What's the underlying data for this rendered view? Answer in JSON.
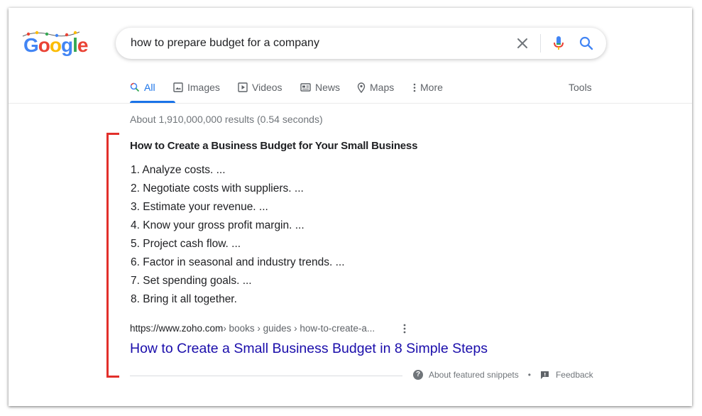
{
  "logo": {
    "text": "Google"
  },
  "search": {
    "query": "how to prepare budget for a company"
  },
  "tabs": [
    {
      "label": "All",
      "icon": "search-icon"
    },
    {
      "label": "Images",
      "icon": "image-icon"
    },
    {
      "label": "Videos",
      "icon": "play-icon"
    },
    {
      "label": "News",
      "icon": "news-icon"
    },
    {
      "label": "Maps",
      "icon": "map-pin-icon"
    },
    {
      "label": "More",
      "icon": "more-vert-icon"
    }
  ],
  "tools_label": "Tools",
  "stats": "About 1,910,000,000 results (0.54 seconds)",
  "snippet": {
    "title": "How to Create a Business Budget for Your Small Business",
    "steps": [
      "1. Analyze costs. ...",
      "2. Negotiate costs with suppliers. ...",
      "3. Estimate your revenue. ...",
      "4. Know your gross profit margin. ...",
      "5. Project cash flow. ...",
      "6. Factor in seasonal and industry trends. ...",
      "7. Set spending goals. ...",
      "8. Bring it all together."
    ],
    "cite_domain": "https://www.zoho.com",
    "cite_path": " › books › guides › how-to-create-a...",
    "result_title": "How to Create a Small Business Budget in 8 Simple Steps",
    "about_label": "About featured snippets",
    "separator": "•",
    "feedback_label": "Feedback"
  },
  "colors": {
    "accent": "#1a73e8",
    "link": "#1a0dab",
    "highlight": "#e2302b"
  }
}
